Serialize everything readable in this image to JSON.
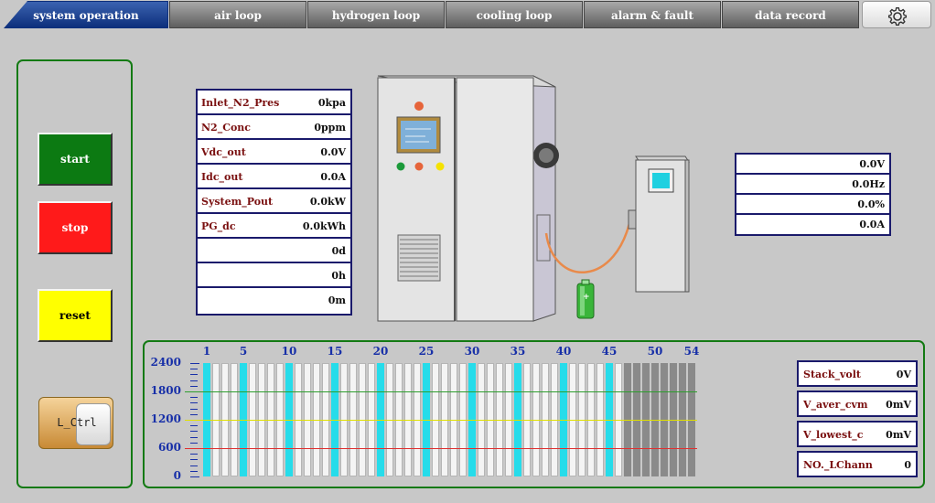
{
  "tabs": [
    {
      "label": "system operation",
      "active": true
    },
    {
      "label": "air loop"
    },
    {
      "label": "hydrogen loop"
    },
    {
      "label": "cooling loop"
    },
    {
      "label": "alarm & fault"
    },
    {
      "label": "data record"
    }
  ],
  "buttons": {
    "start": "start",
    "stop": "stop",
    "reset": "reset",
    "l_ctrl": "L_Ctrl"
  },
  "params": [
    {
      "label": "Inlet_N2_Pres",
      "value": "0kpa"
    },
    {
      "label": "N2_Conc",
      "value": "0ppm"
    },
    {
      "label": "Vdc_out",
      "value": "0.0V"
    },
    {
      "label": "Idc_out",
      "value": "0.0A"
    },
    {
      "label": "System_Pout",
      "value": "0.0kW"
    },
    {
      "label": "PG_dc",
      "value": "0.0kWh"
    },
    {
      "label": "",
      "value": "0d"
    },
    {
      "label": "",
      "value": "0h"
    },
    {
      "label": "",
      "value": "0m"
    }
  ],
  "readouts": [
    "0.0V",
    "0.0Hz",
    "0.0%",
    "0.0A"
  ],
  "cell_chart": {
    "y_ticks": [
      "2400",
      "1800",
      "1200",
      "600",
      "0"
    ],
    "y_values": [
      2400,
      1800,
      1200,
      600,
      0
    ],
    "x_labels": [
      "1",
      "5",
      "10",
      "15",
      "20",
      "25",
      "30",
      "35",
      "40",
      "45",
      "50",
      "54"
    ],
    "cell_count": 54,
    "active_cells": 46,
    "reference_lines": [
      {
        "value": 1800,
        "color": "#2e9e2e"
      },
      {
        "value": 1200,
        "color": "#e0e000"
      },
      {
        "value": 600,
        "color": "#e03030"
      }
    ],
    "cell_values_mV": [
      0,
      0,
      0,
      0,
      0,
      0,
      0,
      0,
      0,
      0,
      0,
      0,
      0,
      0,
      0,
      0,
      0,
      0,
      0,
      0,
      0,
      0,
      0,
      0,
      0,
      0,
      0,
      0,
      0,
      0,
      0,
      0,
      0,
      0,
      0,
      0,
      0,
      0,
      0,
      0,
      0,
      0,
      0,
      0,
      0,
      0,
      0,
      0,
      0,
      0,
      0,
      0,
      0,
      0
    ]
  },
  "stats": [
    {
      "label": "Stack_volt",
      "value": "0V"
    },
    {
      "label": "V_aver_cvm",
      "value": "0mV"
    },
    {
      "label": "V_lowest_c",
      "value": "0mV"
    },
    {
      "label": "NO._LChann",
      "value": "0"
    }
  ],
  "colors": {
    "accent_tab": "#0d2f7c",
    "panel_border": "#137a13",
    "start": "#0c7a12",
    "stop": "#ff1a1a",
    "reset": "#ffff00",
    "highlight_cell": "#26dcea"
  },
  "icons": [
    "gear-icon",
    "fuel-cell-cabinet-icon",
    "control-box-icon",
    "battery-icon"
  ]
}
